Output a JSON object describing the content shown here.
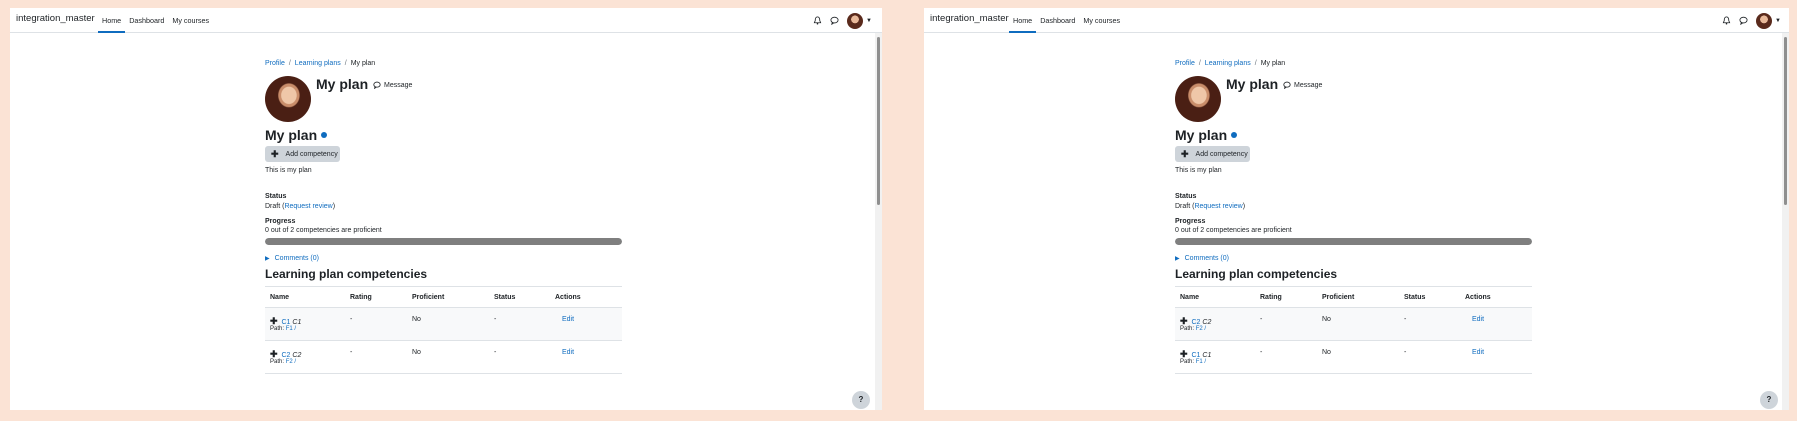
{
  "panels": [
    {
      "brand": "integration_master",
      "nav": [
        "Home",
        "Dashboard",
        "My courses"
      ],
      "breadcrumb": [
        "Profile",
        "Learning plans",
        "My plan"
      ],
      "user_heading": "My plan",
      "message_label": "Message",
      "plan_title": "My plan",
      "add_competency_label": "Add competency",
      "description": "This is my plan",
      "status_label": "Status",
      "status_prefix": "Draft (",
      "status_link": "Request review",
      "status_suffix": ")",
      "progress_label": "Progress",
      "progress_text": "0 out of 2 competencies are proficient",
      "progress_fraction": 0.0,
      "comments_label": "Comments (0)",
      "competencies_heading": "Learning plan competencies",
      "columns": [
        "Name",
        "Rating",
        "Proficient",
        "Status",
        "Actions"
      ],
      "rows": [
        {
          "id": "C1",
          "name": "C1",
          "path_label": "Path:",
          "path_link": "F1",
          "path_sep": "/",
          "rating": "-",
          "proficient": "No",
          "status": "-",
          "action": "Edit"
        },
        {
          "id": "C2",
          "name": "C2",
          "path_label": "Path:",
          "path_link": "F2",
          "path_sep": "/",
          "rating": "-",
          "proficient": "No",
          "status": "-",
          "action": "Edit"
        }
      ],
      "help_label": "?"
    },
    {
      "brand": "integration_master",
      "nav": [
        "Home",
        "Dashboard",
        "My courses"
      ],
      "breadcrumb": [
        "Profile",
        "Learning plans",
        "My plan"
      ],
      "user_heading": "My plan",
      "message_label": "Message",
      "plan_title": "My plan",
      "add_competency_label": "Add competency",
      "description": "This is my plan",
      "status_label": "Status",
      "status_prefix": "Draft (",
      "status_link": "Request review",
      "status_suffix": ")",
      "progress_label": "Progress",
      "progress_text": "0 out of 2 competencies are proficient",
      "progress_fraction": 0.0,
      "comments_label": "Comments (0)",
      "competencies_heading": "Learning plan competencies",
      "columns": [
        "Name",
        "Rating",
        "Proficient",
        "Status",
        "Actions"
      ],
      "rows": [
        {
          "id": "C2",
          "name": "C2",
          "path_label": "Path:",
          "path_link": "F2",
          "path_sep": "/",
          "rating": "-",
          "proficient": "No",
          "status": "-",
          "action": "Edit"
        },
        {
          "id": "C1",
          "name": "C1",
          "path_label": "Path:",
          "path_link": "F1",
          "path_sep": "/",
          "rating": "-",
          "proficient": "No",
          "status": "-",
          "action": "Edit"
        }
      ],
      "help_label": "?"
    }
  ],
  "colors": {
    "accent": "#0f6cbf",
    "page_bg": "#fbe3d5",
    "progress_fill": "#7f7f7f"
  },
  "icons": [
    "bell-icon",
    "chat-icon",
    "avatar",
    "chevron-down-icon",
    "message-icon",
    "info-icon",
    "move-icon",
    "chevron-right-icon",
    "help-icon"
  ]
}
